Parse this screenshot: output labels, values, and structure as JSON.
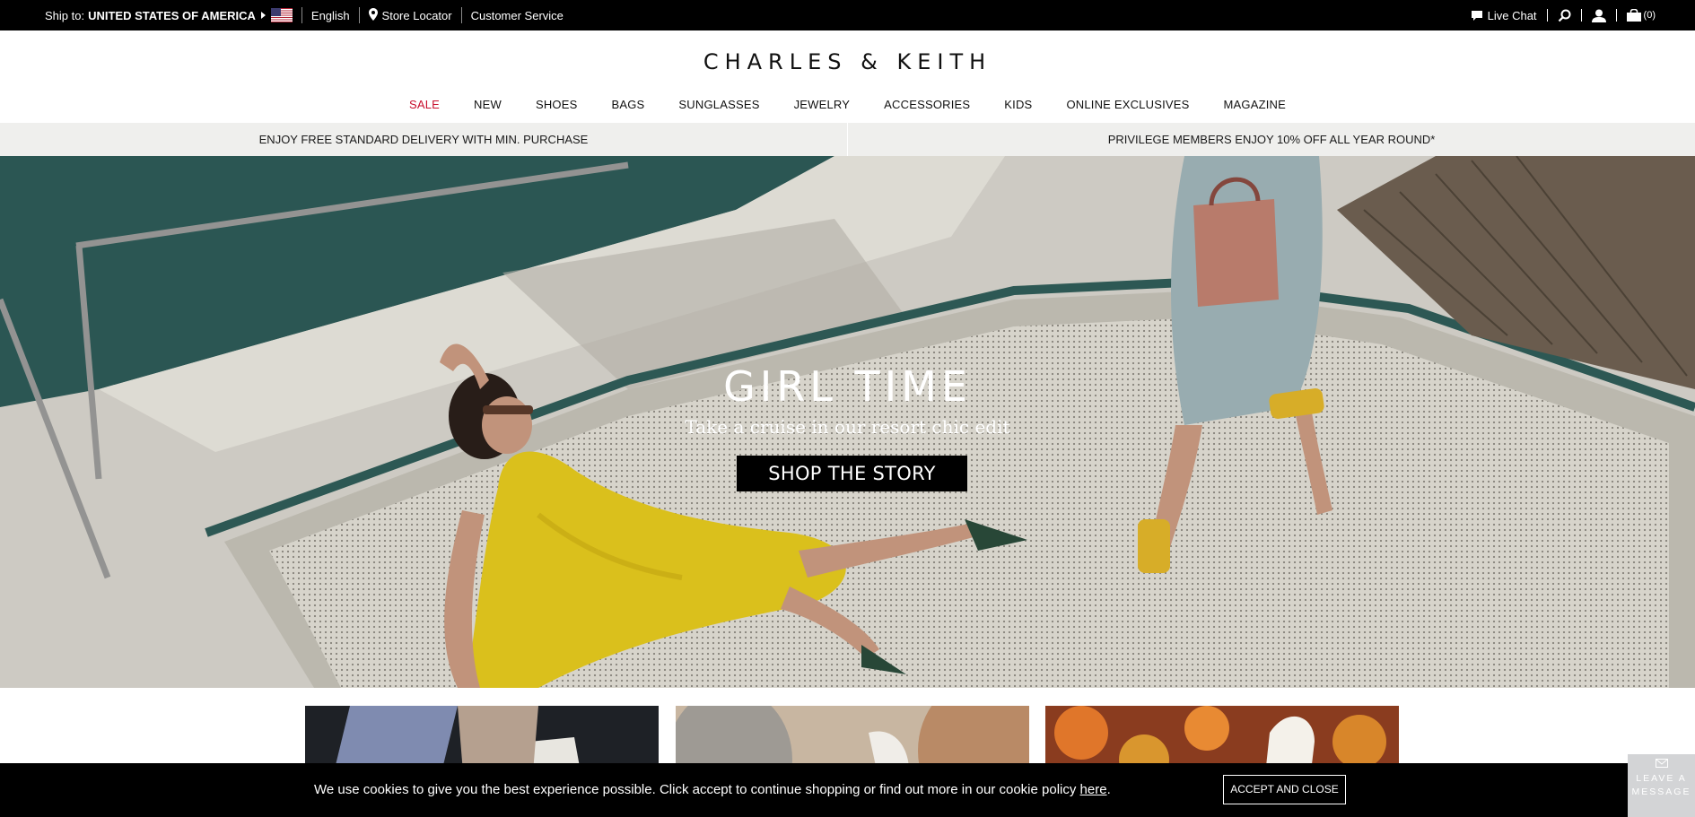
{
  "topbar": {
    "ship_prefix": "Ship to:",
    "ship_country": "UNITED STATES OF AMERICA",
    "language": "English",
    "store_locator": "Store Locator",
    "customer_service": "Customer Service",
    "live_chat": "Live Chat",
    "bag_count": "(0)",
    "icons": [
      "chat-icon",
      "search-icon",
      "account-icon",
      "bag-icon",
      "location-pin-icon",
      "us-flag-icon"
    ]
  },
  "brand": {
    "logo": "CHARLES & KEITH"
  },
  "nav": {
    "items": [
      "SALE",
      "NEW",
      "SHOES",
      "BAGS",
      "SUNGLASSES",
      "JEWELRY",
      "ACCESSORIES",
      "KIDS",
      "ONLINE EXCLUSIVES",
      "MAGAZINE"
    ],
    "sale_color": "#c8102e"
  },
  "promo": {
    "left": "ENJOY FREE STANDARD DELIVERY WITH MIN. PURCHASE",
    "right": "PRIVILEGE MEMBERS ENJOY 10% OFF ALL YEAR ROUND*"
  },
  "hero": {
    "title": "GIRL TIME",
    "subtitle": "Take a cruise in our resort chic edit",
    "cta": "SHOP THE STORY"
  },
  "cookie": {
    "text": "We use cookies to give you the best experience possible. Click accept to continue shopping or find out more in our cookie policy ",
    "link": "here",
    "after_link": ".",
    "button": "ACCEPT AND CLOSE"
  },
  "chat_widget": {
    "label": "LEAVE A MESSAGE"
  }
}
